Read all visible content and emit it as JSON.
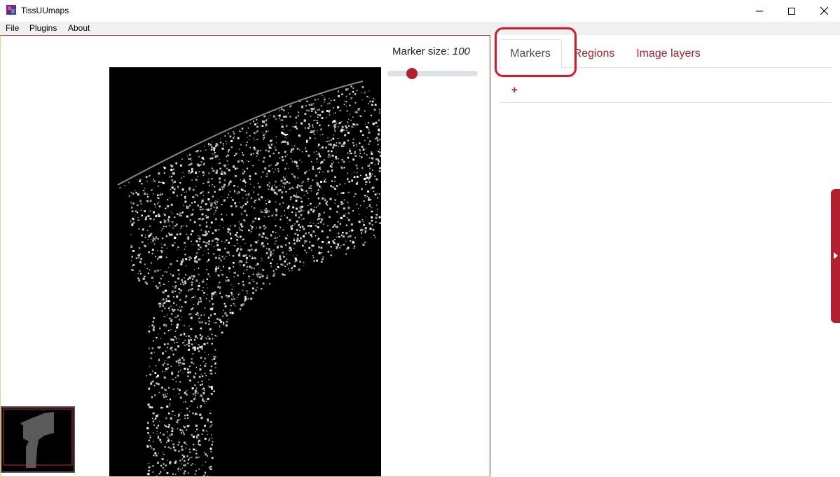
{
  "window": {
    "title": "TissUUmaps",
    "controls": [
      "minimize-icon",
      "maximize-icon",
      "close-icon"
    ]
  },
  "menu": {
    "items": [
      {
        "label": "File"
      },
      {
        "label": "Plugins"
      },
      {
        "label": "About"
      }
    ]
  },
  "viewer": {
    "marker_size_label": "Marker size:",
    "marker_size_value": "100",
    "marker_size_slider_fraction": 0.24
  },
  "panel": {
    "tabs": [
      {
        "label": "Markers",
        "active": true
      },
      {
        "label": "Regions",
        "active": false
      },
      {
        "label": "Image layers",
        "active": false
      }
    ],
    "add_label": "+",
    "collapse_icon": "caret-right-icon"
  },
  "colors": {
    "accent": "#b3202d",
    "highlight": "#e1141f",
    "tissue_background": "#000000"
  }
}
